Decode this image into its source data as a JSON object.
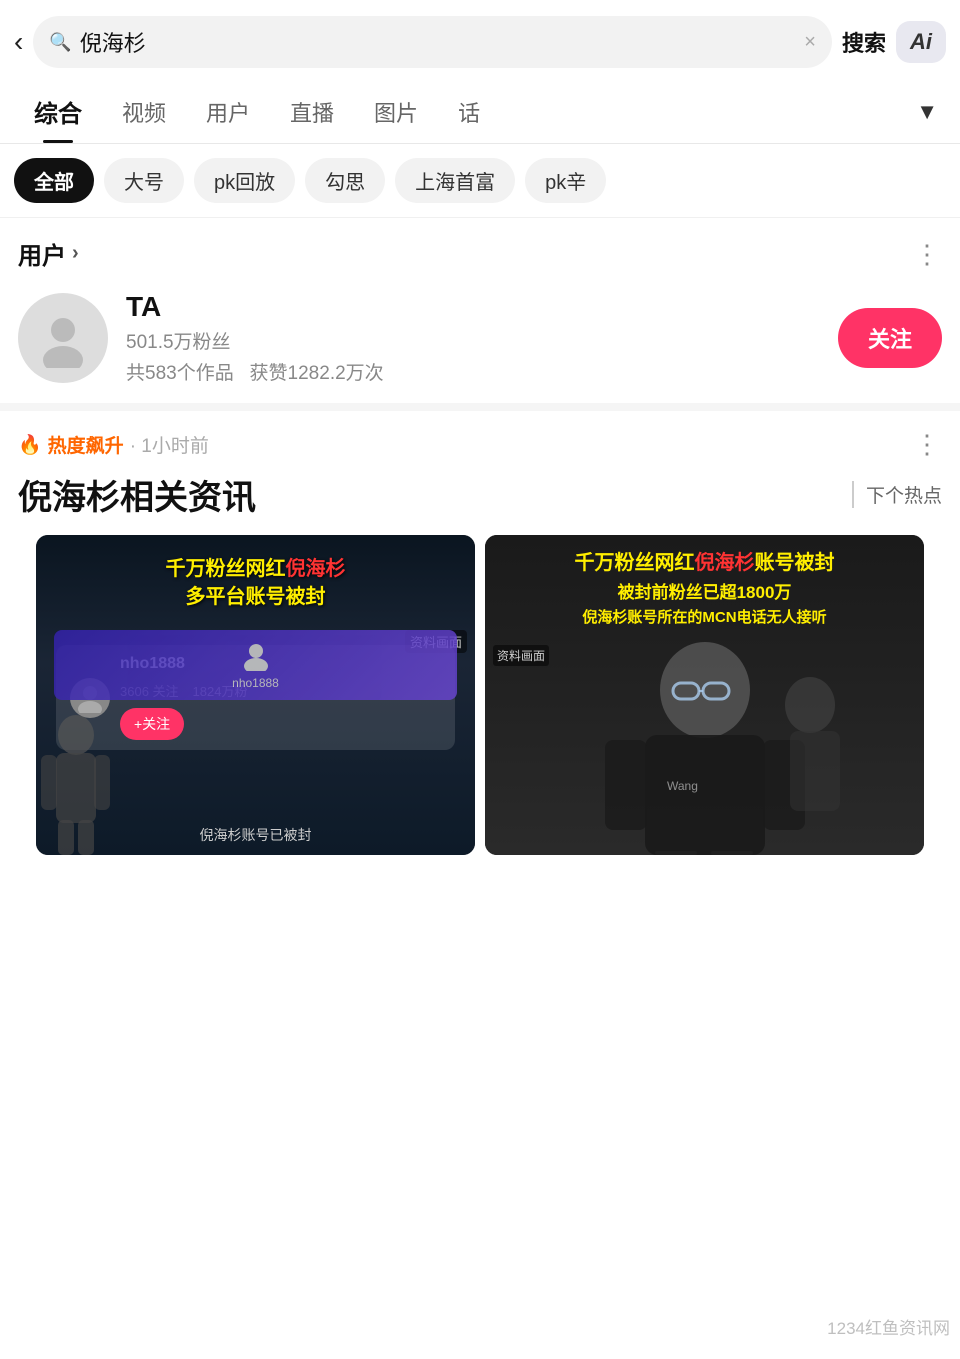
{
  "header": {
    "back_label": "‹",
    "search_placeholder": "倪海杉",
    "search_value": "倪海杉",
    "clear_icon": "×",
    "search_button": "搜索",
    "ai_button": "Ai"
  },
  "category_tabs": {
    "items": [
      {
        "label": "综合",
        "active": true
      },
      {
        "label": "视频",
        "active": false
      },
      {
        "label": "用户",
        "active": false
      },
      {
        "label": "直播",
        "active": false
      },
      {
        "label": "图片",
        "active": false
      },
      {
        "label": "话",
        "active": false
      }
    ],
    "filter_icon": "▼"
  },
  "sub_tags": {
    "items": [
      {
        "label": "全部",
        "active": true
      },
      {
        "label": "大号",
        "active": false
      },
      {
        "label": "pk回放",
        "active": false
      },
      {
        "label": "勾思",
        "active": false
      },
      {
        "label": "上海首富",
        "active": false
      },
      {
        "label": "pk辛",
        "active": false
      }
    ]
  },
  "user_section": {
    "title": "用户",
    "arrow": "›",
    "more_icon": "⋮",
    "user": {
      "name": "TA",
      "fans": "501.5万粉丝",
      "works": "共583个作品",
      "likes": "获赞1282.2万次",
      "follow_button": "关注"
    }
  },
  "hot_section": {
    "fire_icon": "🔥",
    "hot_label": "热度飙升",
    "time": "· 1小时前",
    "more_icon": "⋮",
    "main_title": "倪海杉相关资讯",
    "next_hot": "下个热点",
    "videos": [
      {
        "title_line1": "千万粉丝网红倪海杉",
        "title_line2": "多平台账号被封",
        "label": "资料画面",
        "username": "nho1888",
        "stat1": "3606 关注",
        "stat2": "1824万粉丝",
        "follow": "+关注",
        "bottom_text": "倪海杉账号已被封"
      },
      {
        "title_line1": "千万粉丝网红倪海杉账号被封",
        "title_line2": "被封前粉丝已超1800万",
        "title_line3": "倪海杉账号所在的MCN电话无人接听",
        "label": "资料画面"
      }
    ]
  },
  "watermark": "1234红鱼资讯网"
}
